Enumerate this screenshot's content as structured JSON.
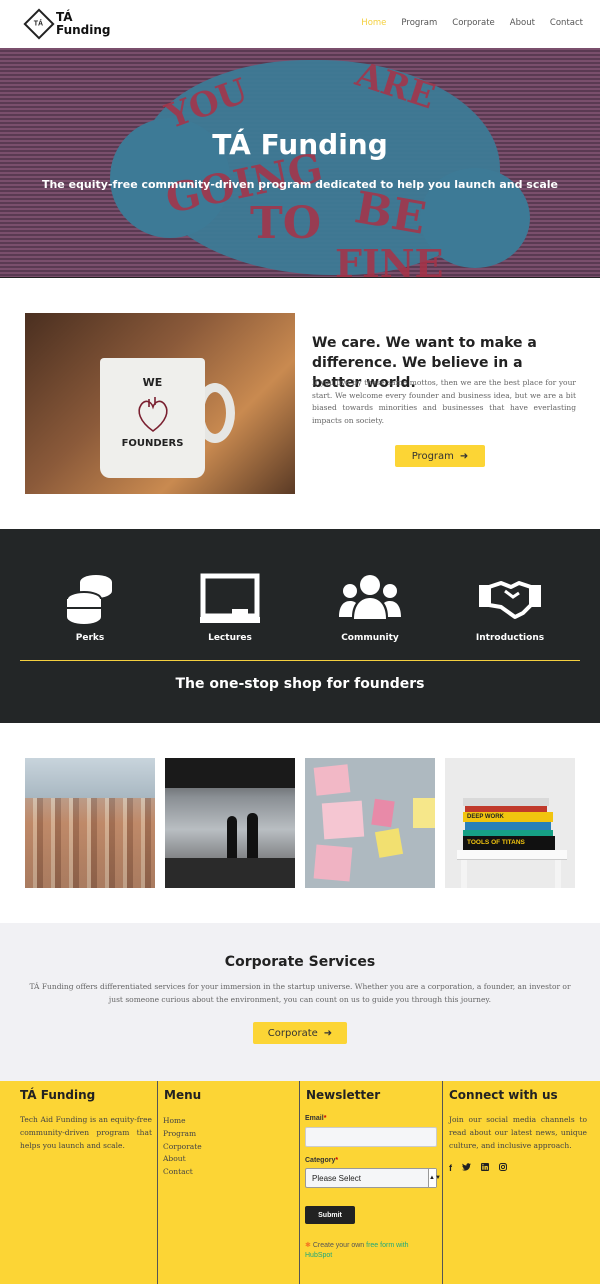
{
  "header": {
    "logo_mark": "TÁ",
    "logo_line1": "TÁ",
    "logo_line2": "Funding",
    "nav": [
      "Home",
      "Program",
      "Corporate",
      "About",
      "Contact"
    ],
    "active": "Home"
  },
  "hero": {
    "title": "TÁ Funding",
    "subtitle": "The equity-free community-driven program dedicated to help you launch and scale",
    "mural_words": [
      "YOU",
      "ARE",
      "GOING",
      "TO",
      "BE",
      "FINE"
    ]
  },
  "about": {
    "mug_line1": "WE",
    "mug_line2": "FOUNDERS",
    "title": "We care. We want to make a difference. We believe in a better world.",
    "text": "If you live by these same mottos, then we are the best place for your start. We welcome every founder and business idea, but we are a bit biased towards minorities and businesses that have everlasting impacts on society.",
    "button": "Program"
  },
  "features": {
    "items": [
      {
        "label": "Perks",
        "icon": "coins-icon"
      },
      {
        "label": "Lectures",
        "icon": "chalkboard-icon"
      },
      {
        "label": "Community",
        "icon": "users-icon"
      },
      {
        "label": "Introductions",
        "icon": "handshake-icon"
      }
    ],
    "tagline": "The one-stop shop for founders"
  },
  "gallery": {
    "book_titles": [
      "DEEP WORK",
      "TOOLS OF TITANS"
    ]
  },
  "corporate": {
    "title": "Corporate Services",
    "text": "TÁ Funding offers differentiated services for your immersion in the startup universe. Whether you are a corporation, a founder, an investor or just someone curious about the environment, you can count on us to guide you through this journey.",
    "button": "Corporate"
  },
  "footer": {
    "brand_title": "TÁ Funding",
    "brand_text": "Tech Aid Funding is an equity-free community-driven program that helps you launch and scale.",
    "menu_title": "Menu",
    "menu": [
      "Home",
      "Program",
      "Corporate",
      "About",
      "Contact"
    ],
    "newsletter_title": "Newsletter",
    "email_label": "Email",
    "category_label": "Category",
    "required_mark": "*",
    "category_selected": "Please Select",
    "submit": "Submit",
    "hubspot_prefix": "Create your own ",
    "hubspot_link": "free form with",
    "hubspot_brand": "HubSpot",
    "connect_title": "Connect with us",
    "connect_text": "Join our social media channels to read about our latest news, unique culture, and inclusive approach.",
    "social": [
      "facebook-icon",
      "twitter-icon",
      "linkedin-icon",
      "instagram-icon"
    ]
  },
  "colors": {
    "accent": "#fcd535",
    "dark": "#232627",
    "hero_blue": "#3d7a96",
    "hero_red": "#a83247"
  }
}
